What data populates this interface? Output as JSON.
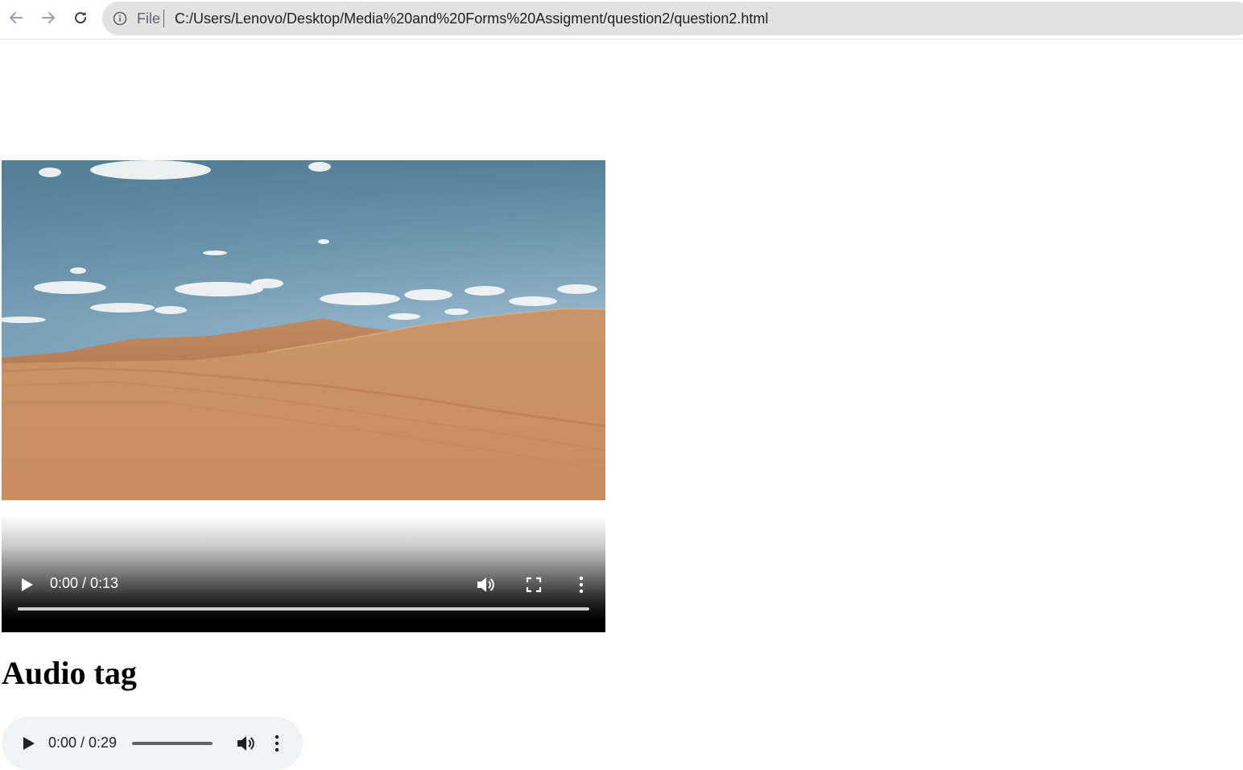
{
  "browser": {
    "url_scheme_label": "File",
    "url": "C:/Users/Lenovo/Desktop/Media%20and%20Forms%20Assigment/question2/question2.html",
    "icons": [
      "back-arrow-icon",
      "forward-arrow-icon",
      "reload-icon",
      "info-icon"
    ]
  },
  "video": {
    "time": "0:00 / 0:13",
    "progress": 0,
    "icons": [
      "play-icon",
      "volume-icon",
      "fullscreen-icon",
      "more-options-icon"
    ]
  },
  "heading": "Audio tag",
  "audio": {
    "time": "0:00 / 0:29",
    "progress": 0,
    "icons": [
      "play-icon",
      "volume-icon",
      "more-options-icon"
    ]
  }
}
